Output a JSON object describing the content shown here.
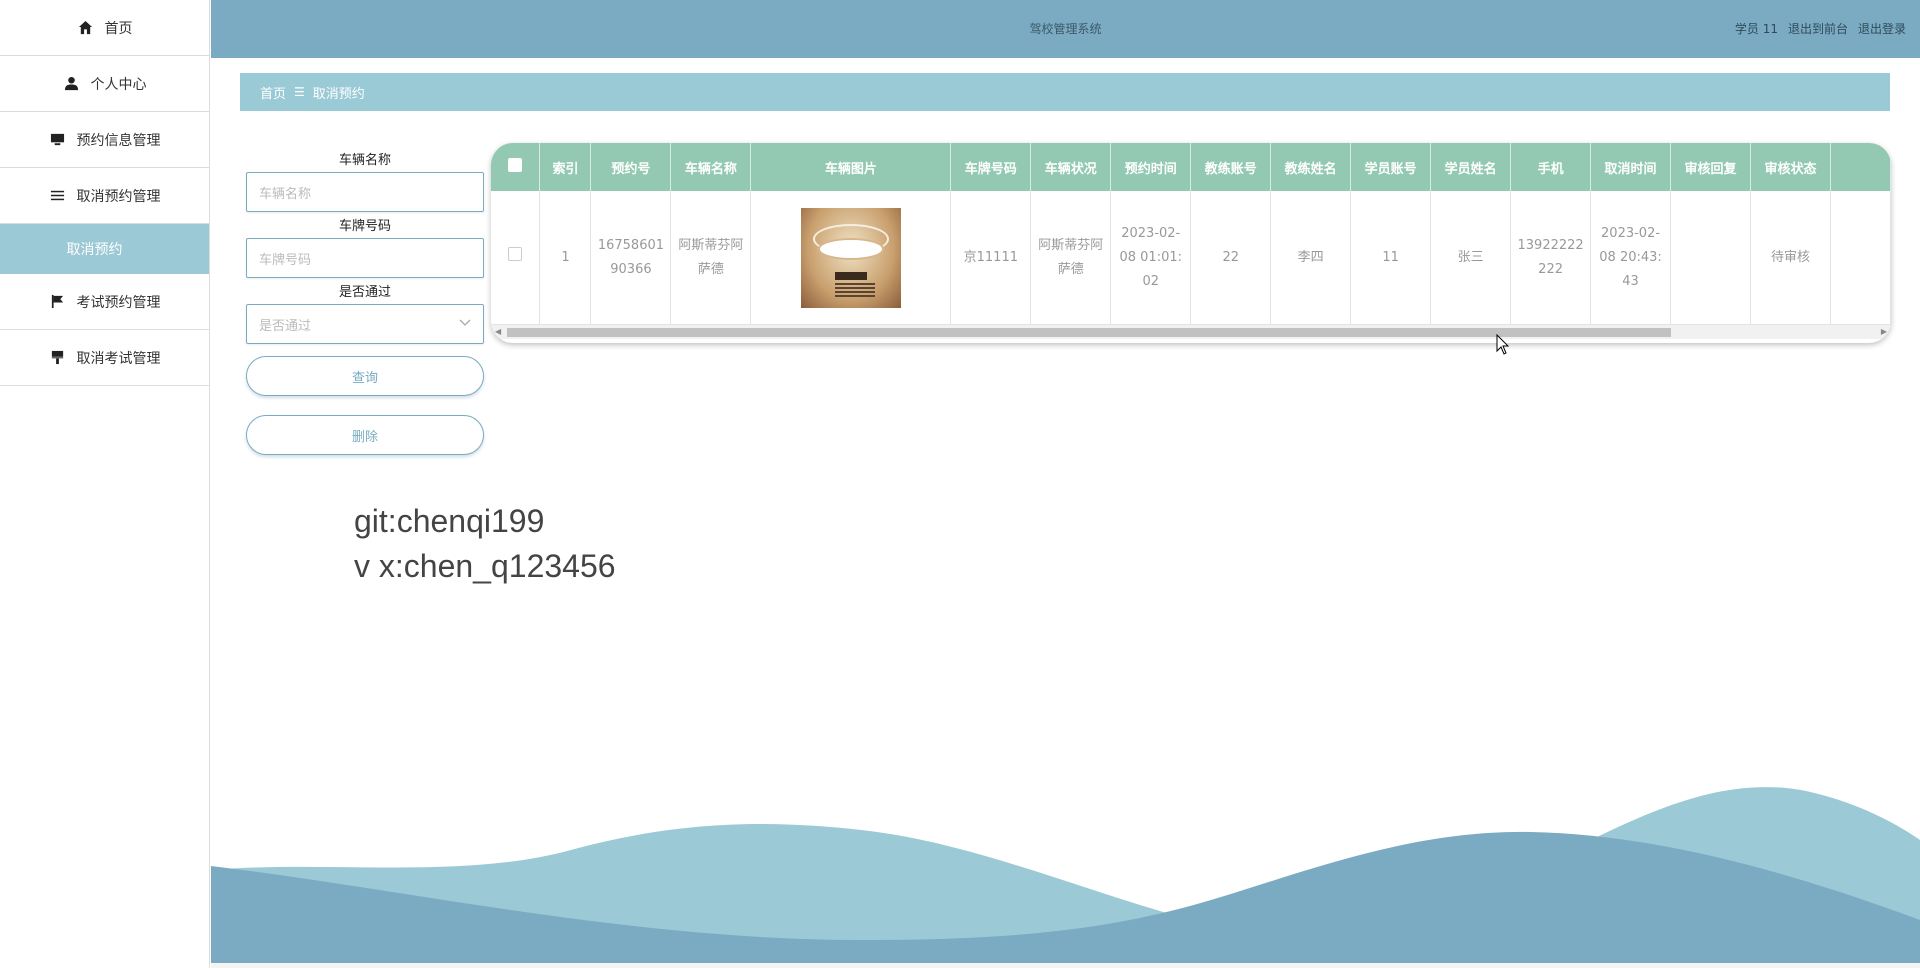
{
  "sidebar": {
    "items": [
      {
        "label": "首页",
        "icon": "home-icon"
      },
      {
        "label": "个人中心",
        "icon": "user-icon"
      },
      {
        "label": "预约信息管理",
        "icon": "monitor-icon"
      },
      {
        "label": "取消预约管理",
        "icon": "list-icon"
      },
      {
        "label": "考试预约管理",
        "icon": "flag-icon"
      },
      {
        "label": "取消考试管理",
        "icon": "brush-icon"
      }
    ],
    "active_sub": "取消预约"
  },
  "header": {
    "title": "驾校管理系统",
    "user": "学员 11",
    "to_front": "退出到前台",
    "logout": "退出登录"
  },
  "breadcrumb": {
    "home": "首页",
    "sep": "☰",
    "current": "取消预约"
  },
  "filter": {
    "vehicle_name_label": "车辆名称",
    "vehicle_name_placeholder": "车辆名称",
    "plate_label": "车牌号码",
    "plate_placeholder": "车牌号码",
    "passed_label": "是否通过",
    "passed_placeholder": "是否通过",
    "query_button": "查询",
    "delete_button": "删除"
  },
  "table": {
    "columns": [
      "索引",
      "预约号",
      "车辆名称",
      "车辆图片",
      "车牌号码",
      "车辆状况",
      "预约时间",
      "教练账号",
      "教练姓名",
      "学员账号",
      "学员姓名",
      "手机",
      "取消时间",
      "审核回复",
      "审核状态"
    ],
    "rows": [
      {
        "index": "1",
        "booking_no": "1675860190366",
        "vehicle_name": "阿斯蒂芬阿萨德",
        "plate": "京11111",
        "condition": "阿斯蒂芬阿萨德",
        "booking_time": "2023-02-08 01:01:02",
        "coach_account": "22",
        "coach_name": "李四",
        "student_account": "11",
        "student_name": "张三",
        "phone": "13922222222",
        "cancel_time": "2023-02-08 20:43:43",
        "review_reply": "",
        "review_status": "待审核"
      }
    ]
  },
  "watermark": {
    "line1": "git:chenqi199",
    "line2": "v x:chen_q123456"
  },
  "colors": {
    "header": "#7aabc2",
    "breadcrumb": "#9bcad7",
    "table_header": "#93c9b3",
    "wave_light": "#9cc9d6",
    "wave_dark": "#7aabc2"
  }
}
